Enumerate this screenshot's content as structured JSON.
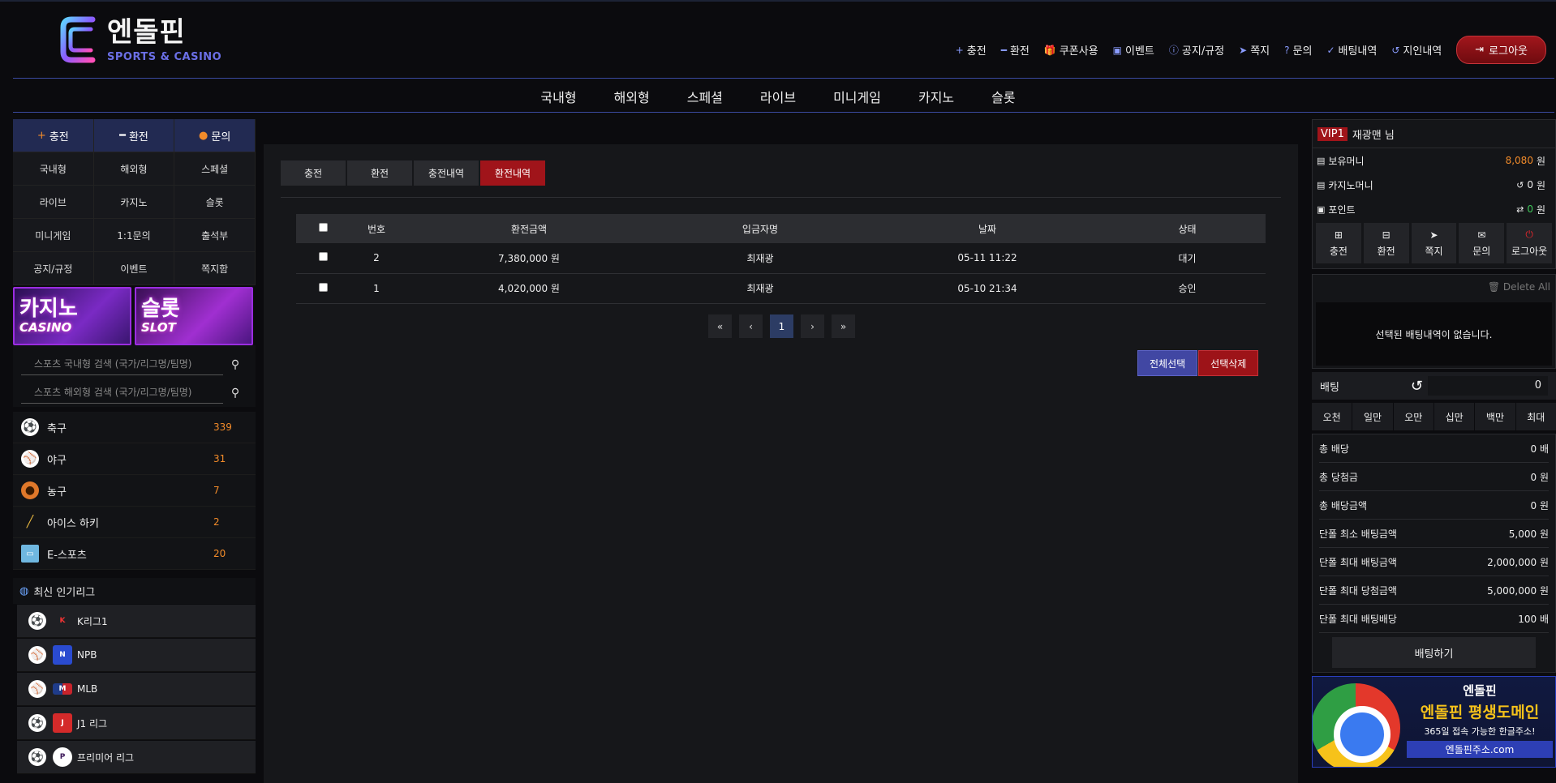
{
  "header": {
    "logo_title": "엔돌핀",
    "logo_sub": "SPORTS & CASINO",
    "top_menu": [
      {
        "icon": "plus-icon",
        "label": "충전"
      },
      {
        "icon": "minus-icon",
        "label": "환전"
      },
      {
        "icon": "gift-icon",
        "label": "쿠폰사용"
      },
      {
        "icon": "calendar-icon",
        "label": "이벤트"
      },
      {
        "icon": "info-icon",
        "label": "공지/규정"
      },
      {
        "icon": "send-icon",
        "label": "쪽지"
      },
      {
        "icon": "question-icon",
        "label": "문의"
      },
      {
        "icon": "check-icon",
        "label": "배팅내역"
      },
      {
        "icon": "history-icon",
        "label": "지인내역"
      }
    ],
    "logout_label": "로그아웃"
  },
  "nav": [
    "국내형",
    "해외형",
    "스페셜",
    "라이브",
    "미니게임",
    "카지노",
    "슬롯"
  ],
  "left": {
    "top_buttons": [
      "충전",
      "환전",
      "문의"
    ],
    "menu": [
      "국내형",
      "해외형",
      "스페셜",
      "라이브",
      "카지노",
      "슬롯",
      "미니게임",
      "1:1문의",
      "출석부",
      "공지/규정",
      "이벤트",
      "쪽지함"
    ],
    "banners": [
      {
        "big": "카지노",
        "small": "CASINO"
      },
      {
        "big": "슬롯",
        "small": "SLOT"
      }
    ],
    "search_domestic_placeholder": "스포츠 국내형 검색 (국가/리그명/팀명)",
    "search_overseas_placeholder": "스포츠 해외형 검색 (국가/리그명/팀명)",
    "sports": [
      {
        "name": "축구",
        "count": "339",
        "icon": "soccer-icon"
      },
      {
        "name": "야구",
        "count": "31",
        "icon": "baseball-icon"
      },
      {
        "name": "농구",
        "count": "7",
        "icon": "basketball-icon"
      },
      {
        "name": "아이스 하키",
        "count": "2",
        "icon": "hockey-icon"
      },
      {
        "name": "E-스포츠",
        "count": "20",
        "icon": "esports-icon"
      }
    ],
    "popular_title": "최신 인기리그",
    "leagues": [
      {
        "name": "K리그1",
        "icon": "soccer-icon"
      },
      {
        "name": "NPB",
        "icon": "baseball-icon"
      },
      {
        "name": "MLB",
        "icon": "baseball-icon"
      },
      {
        "name": "J1 리그",
        "icon": "soccer-icon"
      },
      {
        "name": "프리미어 리그",
        "icon": "soccer-icon"
      }
    ]
  },
  "center": {
    "tabs": [
      "충전",
      "환전",
      "충전내역",
      "환전내역"
    ],
    "active_tab": "환전내역",
    "columns": [
      "번호",
      "환전금액",
      "입금자명",
      "날짜",
      "상태"
    ],
    "rows": [
      {
        "no": "2",
        "amount": "7,380,000 원",
        "name": "최재광",
        "date": "05-11 11:22",
        "status": "대기"
      },
      {
        "no": "1",
        "amount": "4,020,000 원",
        "name": "최재광",
        "date": "05-10 21:34",
        "status": "승인"
      }
    ],
    "pager": {
      "first": "«",
      "prev": "‹",
      "current": "1",
      "next": "›",
      "last": "»"
    },
    "select_all_label": "전체선택",
    "delete_selected_label": "선택삭제"
  },
  "right": {
    "vip": "VIP1",
    "user": "재광맨 님",
    "money": {
      "label": "보유머니",
      "value": "8,080",
      "unit": "원"
    },
    "casino_money": {
      "label": "카지노머니",
      "value": "0",
      "unit": "원"
    },
    "point": {
      "label": "포인트",
      "value": "0",
      "unit": "원"
    },
    "quick": [
      "충전",
      "환전",
      "쪽지",
      "문의",
      "로그아웃"
    ],
    "delete_all": "Delete All",
    "slip_empty": "선택된 배팅내역이 없습니다.",
    "bet_label": "배팅",
    "bet_value": "0",
    "amounts": [
      "오천",
      "일만",
      "오만",
      "십만",
      "백만",
      "최대"
    ],
    "info": [
      {
        "label": "총 배당",
        "value": "0 배"
      },
      {
        "label": "총 당첨금",
        "value": "0 원"
      },
      {
        "label": "총 배당금액",
        "value": "0 원"
      },
      {
        "label": "단폴 최소 배팅금액",
        "value": "5,000 원"
      },
      {
        "label": "단폴 최대 배팅금액",
        "value": "2,000,000 원"
      },
      {
        "label": "단폴 최대 당첨금액",
        "value": "5,000,000 원"
      },
      {
        "label": "단폴 최대 배팅배당",
        "value": "100 배"
      }
    ],
    "submit_label": "배팅하기",
    "promo": {
      "brand": "엔돌핀",
      "title": "엔돌핀 평생도메인",
      "sub": "365일 접속 가능한 한글주소!",
      "url": "엔돌핀주소.com"
    }
  },
  "colors": {
    "accent_red": "#a0141a",
    "accent_blue": "#4147a3",
    "count_orange": "#f28b2a"
  }
}
